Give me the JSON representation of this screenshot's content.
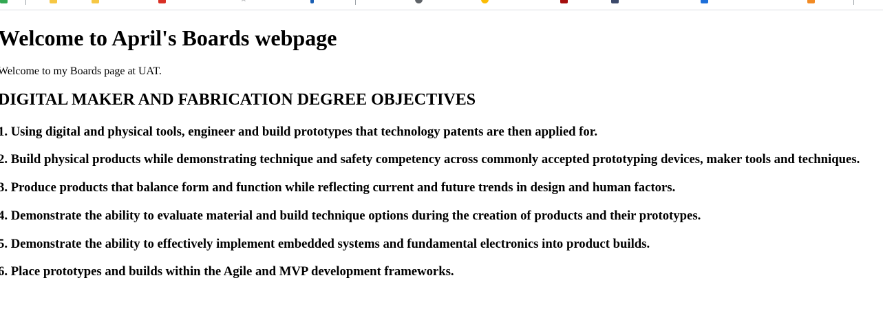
{
  "bookmarks": {
    "icons": [
      {
        "name": "apps-grid-icon",
        "color": "#34a853"
      },
      {
        "name": "folder-icon",
        "color": "#f6c744"
      },
      {
        "name": "folder-icon",
        "color": "#f6c744"
      },
      {
        "name": "red-square-icon",
        "color": "#d93025"
      },
      {
        "name": "star-icon",
        "color": "#5f6368"
      },
      {
        "name": "blue-bar-icon",
        "color": "#1a5fb4"
      },
      {
        "name": "google-icon",
        "color": "#5f6368"
      },
      {
        "name": "smiley-icon",
        "color": "#fbbc04"
      },
      {
        "name": "red-square-icon",
        "color": "#a50e0e"
      },
      {
        "name": "image-icon",
        "color": "#3c4a6b"
      },
      {
        "name": "blue-square-icon",
        "color": "#1e6fd9"
      },
      {
        "name": "orange-icon",
        "color": "#f28b24"
      }
    ]
  },
  "page": {
    "heading": "Welcome to April's Boards webpage",
    "intro": "Welcome to my Boards page at UAT.",
    "subheading": "DIGITAL MAKER AND FABRICATION DEGREE OBJECTIVES",
    "objectives": [
      "1. Using digital and physical tools, engineer and build prototypes that technology patents are then applied for.",
      "2. Build physical products while demonstrating technique and safety competency across commonly accepted prototyping devices, maker tools and techniques.",
      "3. Produce products that balance form and function while reflecting current and future trends in design and human factors.",
      "4. Demonstrate the ability to evaluate material and build technique options during the creation of products and their prototypes.",
      "5. Demonstrate the ability to effectively implement embedded systems and fundamental electronics into product builds.",
      "6. Place prototypes and builds within the Agile and MVP development frameworks."
    ]
  }
}
